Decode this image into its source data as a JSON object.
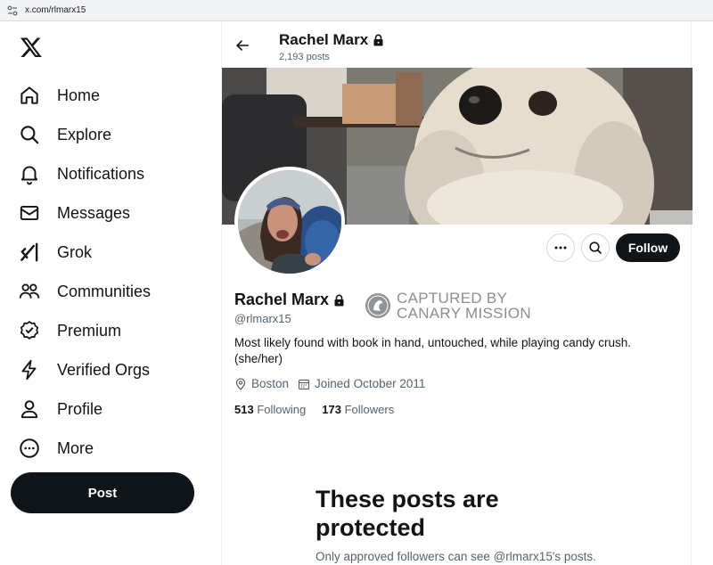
{
  "browser": {
    "url": "x.com/rlmarx15"
  },
  "nav": {
    "items": [
      {
        "label": "Home",
        "icon": "home-icon"
      },
      {
        "label": "Explore",
        "icon": "search-icon"
      },
      {
        "label": "Notifications",
        "icon": "bell-icon"
      },
      {
        "label": "Messages",
        "icon": "envelope-icon"
      },
      {
        "label": "Grok",
        "icon": "grok-icon"
      },
      {
        "label": "Communities",
        "icon": "people-icon"
      },
      {
        "label": "Premium",
        "icon": "verified-badge-icon"
      },
      {
        "label": "Verified Orgs",
        "icon": "lightning-icon"
      },
      {
        "label": "Profile",
        "icon": "person-icon"
      },
      {
        "label": "More",
        "icon": "more-circle-icon"
      }
    ],
    "post_label": "Post"
  },
  "header": {
    "name": "Rachel Marx",
    "post_count": "2,193 posts"
  },
  "profile": {
    "name": "Rachel Marx",
    "handle": "@rlmarx15",
    "bio": "Most likely found with book in hand, untouched, while playing candy crush. (she/her)",
    "location": "Boston",
    "joined": "Joined October 2011",
    "following_count": "513",
    "following_label": "Following",
    "followers_count": "173",
    "followers_label": "Followers",
    "follow_label": "Follow"
  },
  "stamp": {
    "line1": "CAPTURED BY",
    "line2": "CANARY MISSION"
  },
  "protected": {
    "title": "These posts are protected",
    "subtitle": "Only approved followers can see @rlmarx15's posts."
  }
}
